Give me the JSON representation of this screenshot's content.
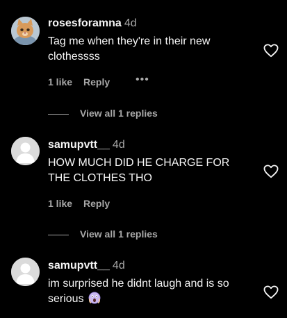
{
  "comments": [
    {
      "username": "rosesforamna",
      "time": "4d",
      "text": "Tag me when they're in their new clothessss",
      "likes": "1 like",
      "reply": "Reply",
      "more": "•••",
      "avatar_icon": "cat-photo-avatar"
    },
    {
      "username": "samupvtt__",
      "time": "4d",
      "text": "HOW MUCH DID HE CHARGE FOR THE CLOTHES THO",
      "likes": "1 like",
      "reply": "Reply",
      "avatar_icon": "default-avatar"
    },
    {
      "username": "samupvtt__",
      "time": "4d",
      "text": "im surprised he didnt laugh and is so serious",
      "emoji": "screaming-face-emoji",
      "avatar_icon": "default-avatar"
    }
  ],
  "view_all_replies": [
    "View all 1 replies",
    "View all 1 replies"
  ],
  "colors": {
    "background": "#000000",
    "text": "#f5f5f5",
    "secondary": "#a8a8a8"
  }
}
